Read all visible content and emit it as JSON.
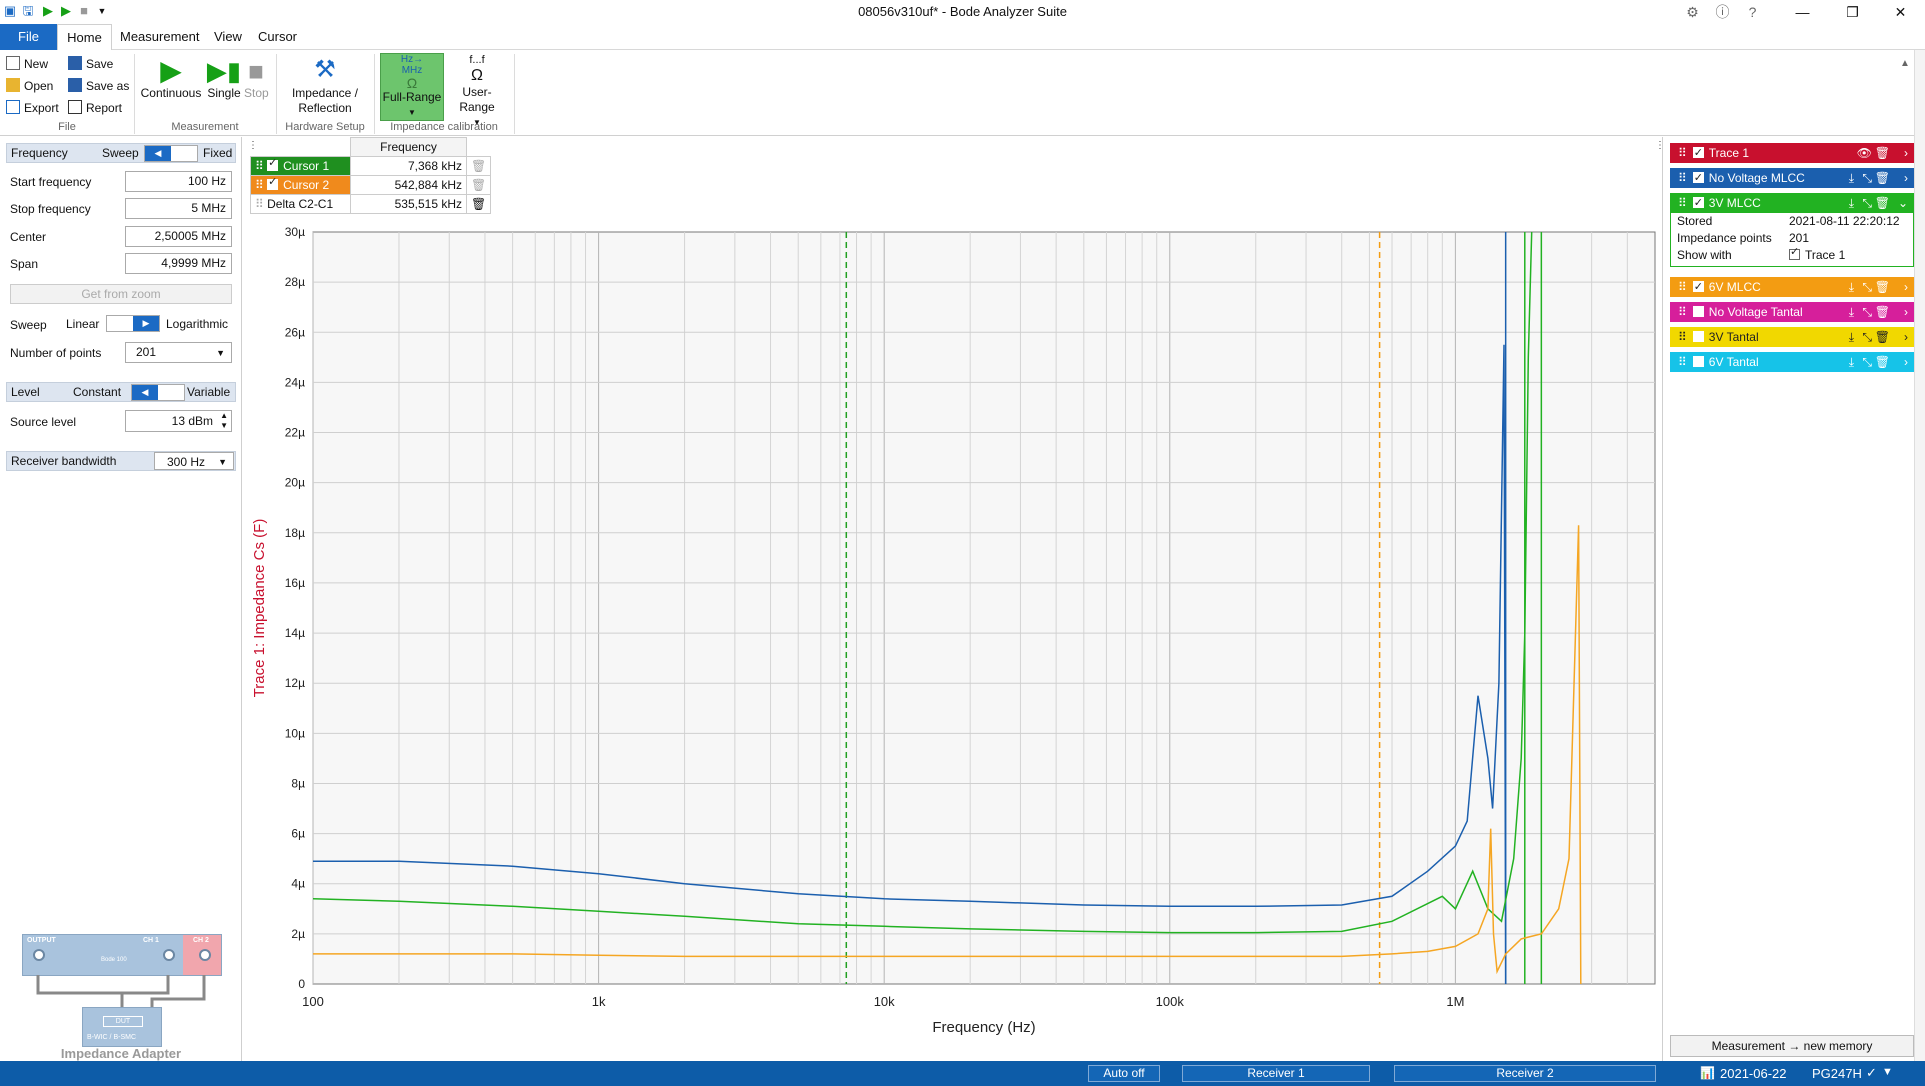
{
  "window": {
    "title": "08056v310uf* - Bode Analyzer Suite"
  },
  "menu": {
    "file": "File",
    "home": "Home",
    "measurement": "Measurement",
    "view": "View",
    "cursor": "Cursor"
  },
  "ribbon": {
    "file_group": {
      "new": "New",
      "open": "Open",
      "export": "Export",
      "save": "Save",
      "save_as": "Save as",
      "report": "Report",
      "label": "File"
    },
    "measurement_group": {
      "continuous": "Continuous",
      "single": "Single",
      "stop": "Stop",
      "label": "Measurement"
    },
    "hardware_group": {
      "impedance_line1": "Impedance /",
      "impedance_line2": "Reflection",
      "label": "Hardware Setup"
    },
    "calibration_group": {
      "full_range_icon_top": "Hz→",
      "full_range_icon_mid": "MHz",
      "full_range": "Full-Range",
      "user_range_icon": "f...f",
      "user_range": "User-Range",
      "label": "Impedance calibration"
    }
  },
  "left": {
    "frequency": {
      "title": "Frequency",
      "sweep": "Sweep",
      "fixed": "Fixed"
    },
    "start_frequency": {
      "label": "Start frequency",
      "value": "100 Hz"
    },
    "stop_frequency": {
      "label": "Stop frequency",
      "value": "5 MHz"
    },
    "center": {
      "label": "Center",
      "value": "2,50005 MHz"
    },
    "span": {
      "label": "Span",
      "value": "4,9999 MHz"
    },
    "get_from_zoom": "Get from zoom",
    "sweep": {
      "label": "Sweep",
      "linear": "Linear",
      "logarithmic": "Logarithmic"
    },
    "points": {
      "label": "Number of points",
      "value": "201"
    },
    "level": {
      "title": "Level",
      "constant": "Constant",
      "variable": "Variable"
    },
    "source_level": {
      "label": "Source level",
      "value": "13 dBm"
    },
    "receiver_bandwidth": {
      "label": "Receiver bandwidth",
      "value": "300 Hz"
    },
    "adapter": {
      "output": "OUTPUT",
      "ch1": "CH 1",
      "ch2": "CH 2",
      "bode": "Bode 100",
      "dut": "DUT",
      "model": "B-WIC / B-SMC",
      "name": "Impedance Adapter"
    }
  },
  "cursor_table": {
    "header": "Frequency",
    "rows": [
      {
        "name": "Cursor 1",
        "value": "7,368 kHz"
      },
      {
        "name": "Cursor 2",
        "value": "542,884 kHz"
      },
      {
        "name": "Delta C2-C1",
        "value": "535,515 kHz"
      }
    ]
  },
  "traces": [
    {
      "name": "Trace 1",
      "color": "#c8102e",
      "checked": true
    },
    {
      "name": "No Voltage MLCC",
      "color": "#1b5fae",
      "checked": true
    },
    {
      "name": "3V MLCC",
      "color": "#22b222",
      "checked": true
    },
    {
      "name": "6V MLCC",
      "color": "#f39c12",
      "checked": true
    },
    {
      "name": "No Voltage Tantal",
      "color": "#d61f9b",
      "checked": false
    },
    {
      "name": "3V Tantal",
      "color": "#f1d800",
      "checked": false
    },
    {
      "name": "6V Tantal",
      "color": "#16c3e8",
      "checked": false
    }
  ],
  "trace_details": {
    "stored_label": "Stored",
    "stored_value": "2021-08-11 22:20:12",
    "points_label": "Impedance points",
    "points_value": "201",
    "show_with_label": "Show with",
    "show_with_value": "Trace 1"
  },
  "measurement_button": "Measurement → new memory",
  "status": {
    "auto_off": "Auto off",
    "receiver1": "Receiver 1",
    "receiver2": "Receiver 2",
    "date": "2021-06-22",
    "device": "PG247H"
  },
  "chart_data": {
    "type": "line",
    "xlabel": "Frequency (Hz)",
    "ylabel": "Trace 1: Impedance Cs (F)",
    "xscale": "log",
    "xlim": [
      100,
      5000000
    ],
    "ylim": [
      0,
      30
    ],
    "y_unit": "µ",
    "x_ticks": [
      {
        "v": 100,
        "label": "100"
      },
      {
        "v": 1000,
        "label": "1k"
      },
      {
        "v": 10000,
        "label": "10k"
      },
      {
        "v": 100000,
        "label": "100k"
      },
      {
        "v": 1000000,
        "label": "1M"
      }
    ],
    "y_ticks": [
      {
        "v": 0,
        "label": "0"
      },
      {
        "v": 2,
        "label": "2µ"
      },
      {
        "v": 4,
        "label": "4µ"
      },
      {
        "v": 6,
        "label": "6µ"
      },
      {
        "v": 8,
        "label": "8µ"
      },
      {
        "v": 10,
        "label": "10µ"
      },
      {
        "v": 12,
        "label": "12µ"
      },
      {
        "v": 14,
        "label": "14µ"
      },
      {
        "v": 16,
        "label": "16µ"
      },
      {
        "v": 18,
        "label": "18µ"
      },
      {
        "v": 20,
        "label": "20µ"
      },
      {
        "v": 22,
        "label": "22µ"
      },
      {
        "v": 24,
        "label": "24µ"
      },
      {
        "v": 26,
        "label": "26µ"
      },
      {
        "v": 28,
        "label": "28µ"
      },
      {
        "v": 30,
        "label": "30µ"
      }
    ],
    "grid": true,
    "cursors": [
      {
        "x": 7368,
        "color": "#22a022"
      },
      {
        "x": 542884,
        "color": "#f39c12"
      }
    ],
    "markers": [
      {
        "x": 1500000,
        "color": "#1b5fae"
      },
      {
        "x": 1750000,
        "color": "#22b222"
      },
      {
        "x": 2000000,
        "color": "#22b222"
      }
    ],
    "series": [
      {
        "color": "#1b5fae",
        "points": [
          [
            100,
            4.9
          ],
          [
            200,
            4.9
          ],
          [
            500,
            4.7
          ],
          [
            1000,
            4.4
          ],
          [
            2000,
            4.0
          ],
          [
            5000,
            3.6
          ],
          [
            10000,
            3.4
          ],
          [
            20000,
            3.3
          ],
          [
            50000,
            3.15
          ],
          [
            100000,
            3.1
          ],
          [
            200000,
            3.1
          ],
          [
            400000,
            3.15
          ],
          [
            600000,
            3.5
          ],
          [
            800000,
            4.5
          ],
          [
            1000000,
            5.5
          ],
          [
            1100000,
            6.5
          ],
          [
            1200000,
            11.5
          ],
          [
            1300000,
            9.0
          ],
          [
            1350000,
            7.0
          ],
          [
            1420000,
            12.0
          ],
          [
            1480000,
            25.5
          ],
          [
            1500000,
            0
          ]
        ]
      },
      {
        "color": "#22b222",
        "points": [
          [
            100,
            3.4
          ],
          [
            200,
            3.3
          ],
          [
            500,
            3.1
          ],
          [
            1000,
            2.9
          ],
          [
            2000,
            2.7
          ],
          [
            5000,
            2.4
          ],
          [
            10000,
            2.3
          ],
          [
            20000,
            2.2
          ],
          [
            50000,
            2.1
          ],
          [
            100000,
            2.05
          ],
          [
            200000,
            2.05
          ],
          [
            400000,
            2.1
          ],
          [
            600000,
            2.5
          ],
          [
            900000,
            3.5
          ],
          [
            1000000,
            3.0
          ],
          [
            1150000,
            4.5
          ],
          [
            1300000,
            3.0
          ],
          [
            1450000,
            2.5
          ],
          [
            1600000,
            5.0
          ],
          [
            1700000,
            9.0
          ],
          [
            1750000,
            14.0
          ],
          [
            1800000,
            25.0
          ],
          [
            1850000,
            30.0
          ]
        ]
      },
      {
        "color": "#f5a623",
        "points": [
          [
            100,
            1.2
          ],
          [
            200,
            1.2
          ],
          [
            500,
            1.2
          ],
          [
            1000,
            1.15
          ],
          [
            2000,
            1.1
          ],
          [
            5000,
            1.1
          ],
          [
            10000,
            1.1
          ],
          [
            20000,
            1.1
          ],
          [
            50000,
            1.1
          ],
          [
            100000,
            1.1
          ],
          [
            200000,
            1.1
          ],
          [
            400000,
            1.1
          ],
          [
            600000,
            1.2
          ],
          [
            800000,
            1.3
          ],
          [
            1000000,
            1.5
          ],
          [
            1200000,
            2.0
          ],
          [
            1300000,
            3.0
          ],
          [
            1330000,
            6.2
          ],
          [
            1360000,
            2.0
          ],
          [
            1400000,
            0.5
          ],
          [
            1500000,
            1.2
          ],
          [
            1700000,
            1.8
          ],
          [
            2000000,
            2.0
          ],
          [
            2300000,
            3.0
          ],
          [
            2500000,
            5.0
          ],
          [
            2700000,
            18.3
          ],
          [
            2750000,
            0
          ]
        ]
      }
    ]
  }
}
